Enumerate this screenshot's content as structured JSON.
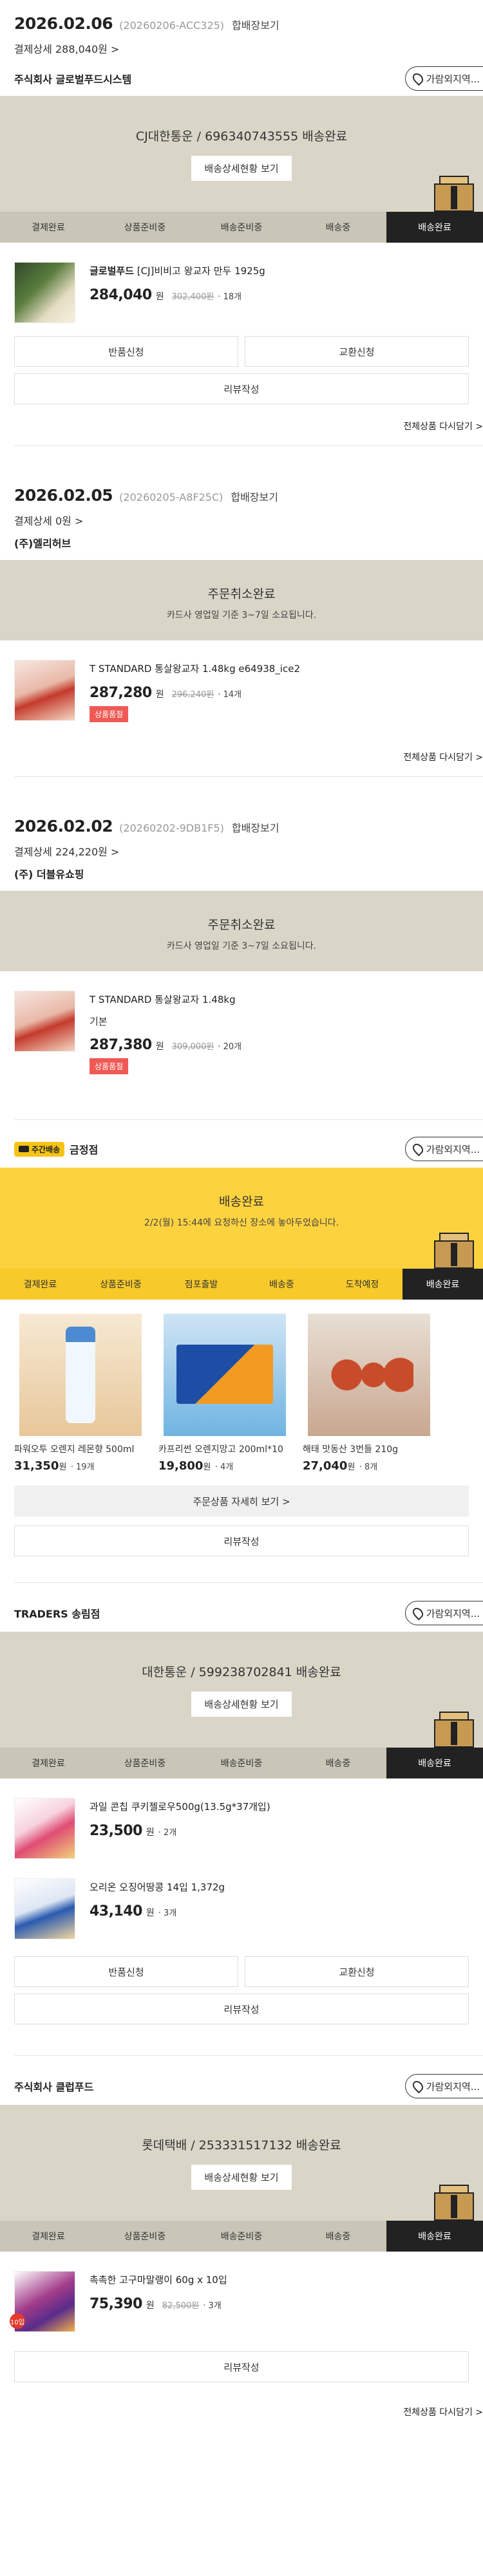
{
  "orders": [
    {
      "date": "2026.02.06",
      "order_no": "(20260206-ACC325)",
      "combined_view": "합배장보기",
      "pay_detail": "결제상세 288,040원 >",
      "seller": "주식회사 글로벌푸드시스템",
      "store_button": "가람외지역...",
      "status_title": "CJ대한통운 / 696340743555 배송완료",
      "track_button": "배송상세현황 보기",
      "steps": [
        "결제완료",
        "상품준비중",
        "배송준비중",
        "배송중",
        "배송완료"
      ],
      "product": {
        "brand": "글로벌푸드",
        "name": "[CJ]비비고 왕교자 만두 1925g",
        "price": "284,040",
        "won": "원",
        "original": "302,400원",
        "qty": "· 18개"
      },
      "buttons": {
        "return": "반품신청",
        "exchange": "교환신청",
        "review": "리뷰작성"
      },
      "rebuy": "전체상품 다시담기 >"
    },
    {
      "date": "2026.02.05",
      "order_no": "(20260205-A8F25C)",
      "combined_view": "합배장보기",
      "pay_detail": "결제상세 0원 >",
      "seller": "(주)엘리허브",
      "status_title": "주문취소완료",
      "status_sub": "카드사 영업일 기준 3~7일 소요됩니다.",
      "product": {
        "name": "T STANDARD 통살왕교자 1.48kg e64938_ice2",
        "price": "287,280",
        "won": "원",
        "original": "296,240원",
        "qty": "· 14개",
        "soldout": "상품품절"
      },
      "rebuy": "전체상품 다시담기 >"
    },
    {
      "date": "2026.02.02",
      "order_no": "(20260202-9DB1F5)",
      "combined_view": "합배장보기",
      "pay_detail": "결제상세 224,220원 >",
      "seller": "(주) 더블유쇼핑",
      "status_title": "주문취소완료",
      "status_sub": "카드사 영업일 기준 3~7일 소요됩니다.",
      "product": {
        "name": "T STANDARD 통살왕교자 1.48kg",
        "option": "기본",
        "price": "287,380",
        "won": "원",
        "original": "309,000원",
        "qty": "· 20개",
        "soldout": "상품품절"
      }
    }
  ],
  "emart": {
    "badge": "주간배송",
    "store": "금정점",
    "store_button": "가람외지역...",
    "status_title": "배송완료",
    "status_sub": "2/2(월) 15:44에 요청하신 장소에 놓아두었습니다.",
    "steps": [
      "결제완료",
      "상품준비중",
      "점포출발",
      "배송중",
      "도착예정",
      "배송완료"
    ],
    "items": [
      {
        "name": "파워오투 오렌지 레몬향 500ml",
        "price": "31,350",
        "won": "원",
        "qty": "· 19개"
      },
      {
        "name": "카프리썬 오렌지망고 200ml*10",
        "price": "19,800",
        "won": "원",
        "qty": "· 4개"
      },
      {
        "name": "해태 맛동산 3번들 210g",
        "price": "27,040",
        "won": "원",
        "qty": "· 8개"
      }
    ],
    "detail_button": "주문상품 자세히 보기 >",
    "review": "리뷰작성"
  },
  "traders": {
    "store": "TRADERS 송림점",
    "store_button": "가람외지역...",
    "status_title": "대한통운 / 599238702841 배송완료",
    "track_button": "배송상세현황 보기",
    "steps": [
      "결제완료",
      "상품준비중",
      "배송준비중",
      "배송중",
      "배송완료"
    ],
    "items": [
      {
        "name": "과일 콘칩 쿠키젤로우500g(13.5g*37개입)",
        "price": "23,500",
        "won": "원",
        "qty": "· 2개"
      },
      {
        "name": "오리온 오징어땅콩 14입 1,372g",
        "price": "43,140",
        "won": "원",
        "qty": "· 3개"
      }
    ],
    "buttons": {
      "return": "반품신청",
      "exchange": "교환신청",
      "review": "리뷰작성"
    }
  },
  "clubfood": {
    "seller": "주식회사 클럽푸드",
    "store_button": "가람외지역...",
    "status_title": "롯데택배 / 253331517132 배송완료",
    "track_button": "배송상세현황 보기",
    "steps": [
      "결제완료",
      "상품준비중",
      "배송준비중",
      "배송중",
      "배송완료"
    ],
    "product": {
      "name": "촉촉한 고구마말랭이 60g x 10입",
      "price": "75,390",
      "won": "원",
      "original": "82,500원",
      "qty": "· 3개",
      "badge": "10입"
    },
    "review": "리뷰작성",
    "rebuy": "전체상품 다시담기 >"
  }
}
